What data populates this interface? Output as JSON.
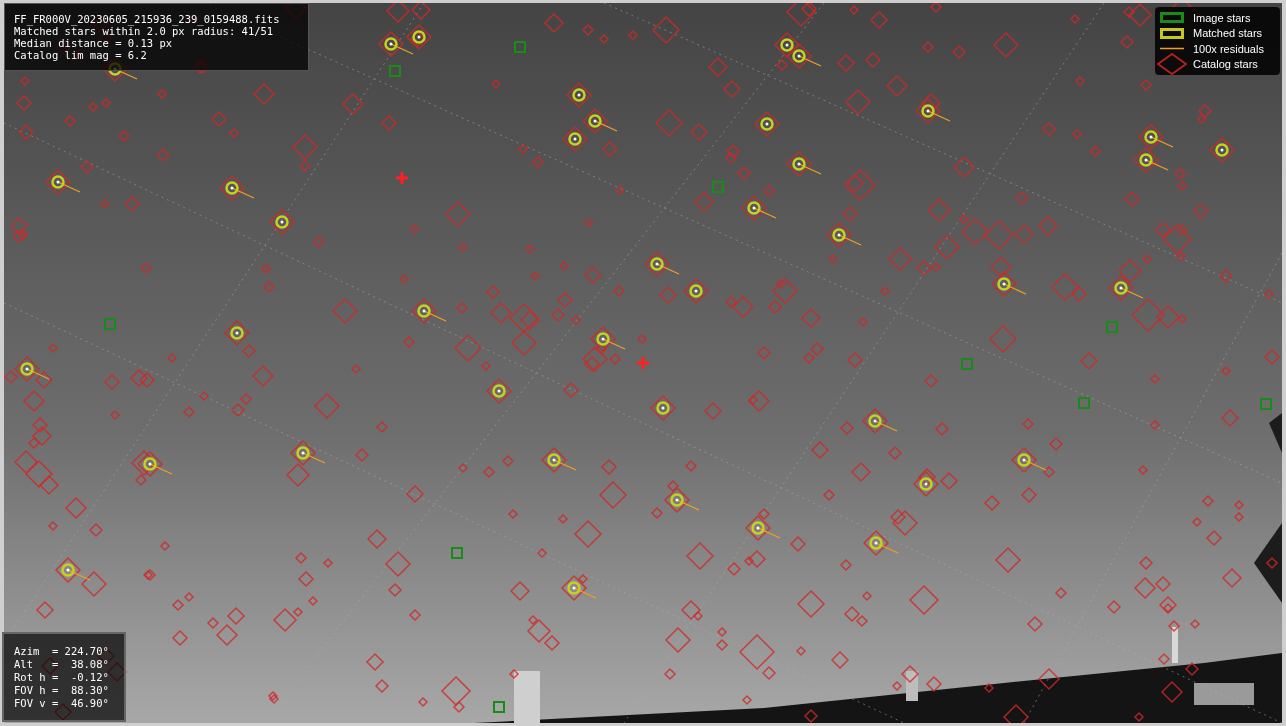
{
  "info_box": {
    "lines": [
      "FF_FR000V_20230605_215936_239_0159488.fits",
      "Matched stars within 2.0 px radius: 41/51",
      "Median distance = 0.13 px",
      "Catalog lim mag = 6.2"
    ]
  },
  "legend": [
    {
      "label": "Image stars"
    },
    {
      "kind": "matched",
      "label": "Matched stars"
    },
    {
      "kind": "residual",
      "label": "100x residuals"
    },
    {
      "kind": "catalog",
      "label": "Catalog stars"
    }
  ],
  "pointing": {
    "lines": [
      "Azim  = 224.70°",
      "Alt   =  38.08°",
      "Rot h =  -0.12°",
      "FOV h =  88.30°",
      "FOV v =  46.90°"
    ]
  }
}
